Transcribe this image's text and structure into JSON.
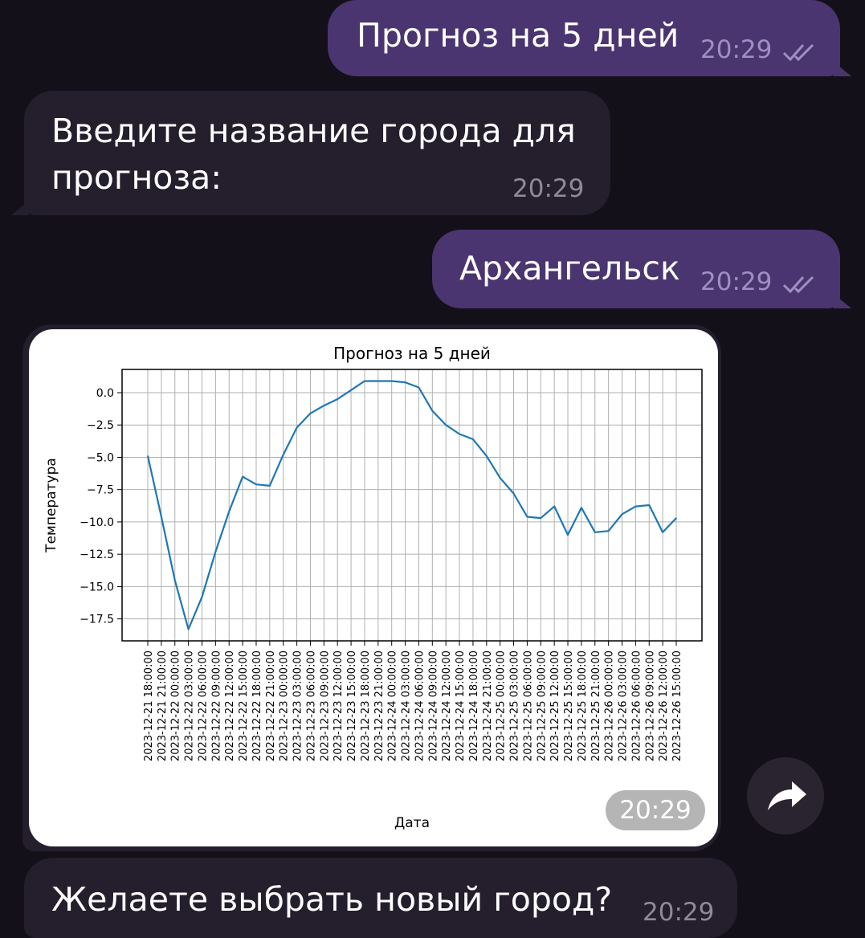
{
  "messages": [
    {
      "text": "Прогноз на 5 дней",
      "time": "20:29"
    },
    {
      "line1": "Введите название города для",
      "line2": "прогноза:",
      "time": "20:29"
    },
    {
      "text": "Архангельск",
      "time": "20:29"
    },
    {
      "time": "20:29"
    },
    {
      "text": "Желаете выбрать новый город?",
      "time": "20:29"
    }
  ],
  "colors": {
    "background": "#141019",
    "outgoing_bubble": "#4a3570",
    "incoming_bubble": "#241e2d",
    "line": "#1f77b4"
  },
  "icons": {
    "read_status": "double-check-icon",
    "share": "share-arrow-icon"
  },
  "chart_data": {
    "type": "line",
    "title": "Прогноз на 5 дней",
    "xlabel": "Дата",
    "ylabel": "Температура",
    "grid": true,
    "ylim": [
      -19.2,
      1.8
    ],
    "yticks": [
      0.0,
      -2.5,
      -5.0,
      -7.5,
      -10.0,
      -12.5,
      -15.0,
      -17.5
    ],
    "ytick_labels": [
      "0.0",
      "−2.5",
      "−5.0",
      "−7.5",
      "−10.0",
      "−12.5",
      "−15.0",
      "−17.5"
    ],
    "categories": [
      "2023-12-21 18:00:00",
      "2023-12-21 21:00:00",
      "2023-12-22 00:00:00",
      "2023-12-22 03:00:00",
      "2023-12-22 06:00:00",
      "2023-12-22 09:00:00",
      "2023-12-22 12:00:00",
      "2023-12-22 15:00:00",
      "2023-12-22 18:00:00",
      "2023-12-22 21:00:00",
      "2023-12-23 00:00:00",
      "2023-12-23 03:00:00",
      "2023-12-23 06:00:00",
      "2023-12-23 09:00:00",
      "2023-12-23 12:00:00",
      "2023-12-23 15:00:00",
      "2023-12-23 18:00:00",
      "2023-12-23 21:00:00",
      "2023-12-24 00:00:00",
      "2023-12-24 03:00:00",
      "2023-12-24 06:00:00",
      "2023-12-24 09:00:00",
      "2023-12-24 12:00:00",
      "2023-12-24 15:00:00",
      "2023-12-24 18:00:00",
      "2023-12-24 21:00:00",
      "2023-12-25 00:00:00",
      "2023-12-25 03:00:00",
      "2023-12-25 06:00:00",
      "2023-12-25 09:00:00",
      "2023-12-25 12:00:00",
      "2023-12-25 15:00:00",
      "2023-12-25 18:00:00",
      "2023-12-25 21:00:00",
      "2023-12-26 00:00:00",
      "2023-12-26 03:00:00",
      "2023-12-26 06:00:00",
      "2023-12-26 09:00:00",
      "2023-12-26 12:00:00",
      "2023-12-26 15:00:00"
    ],
    "values": [
      -4.9,
      -9.6,
      -14.5,
      -18.3,
      -15.8,
      -12.3,
      -9.2,
      -6.5,
      -7.1,
      -7.2,
      -4.8,
      -2.7,
      -1.6,
      -1.0,
      -0.5,
      0.2,
      0.9,
      0.9,
      0.9,
      0.8,
      0.4,
      -1.4,
      -2.5,
      -3.2,
      -3.6,
      -4.9,
      -6.6,
      -7.8,
      -9.6,
      -9.7,
      -8.8,
      -11.0,
      -8.9,
      -10.8,
      -10.7,
      -9.4,
      -8.8,
      -8.7,
      -10.8,
      -9.7
    ]
  }
}
